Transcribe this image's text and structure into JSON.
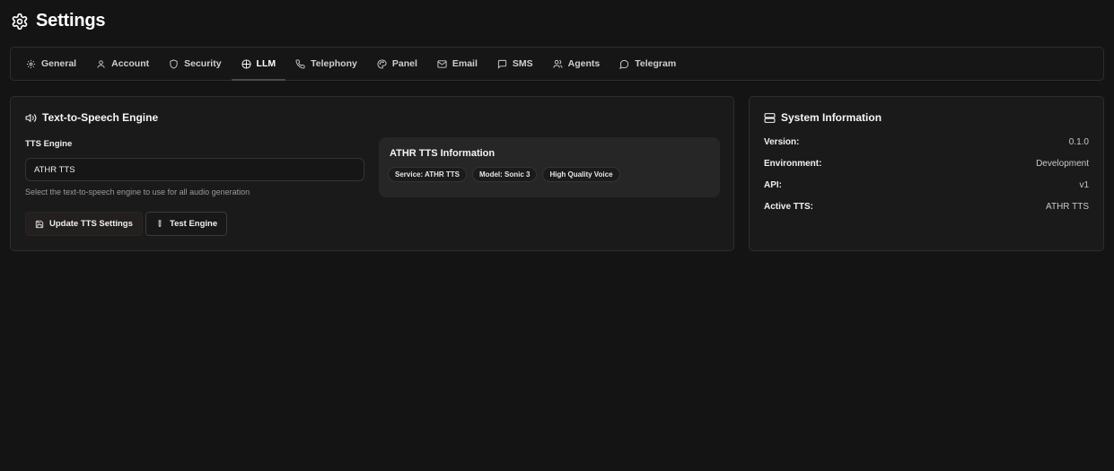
{
  "header": {
    "title": "Settings",
    "icon": "gear-icon"
  },
  "tabs": [
    {
      "label": "General",
      "icon": "gear-icon",
      "active": false
    },
    {
      "label": "Account",
      "icon": "user-icon",
      "active": false
    },
    {
      "label": "Security",
      "icon": "shield-icon",
      "active": false
    },
    {
      "label": "LLM",
      "icon": "globe-icon",
      "active": true
    },
    {
      "label": "Telephony",
      "icon": "phone-icon",
      "active": false
    },
    {
      "label": "Panel",
      "icon": "palette-icon",
      "active": false
    },
    {
      "label": "Email",
      "icon": "mail-icon",
      "active": false
    },
    {
      "label": "SMS",
      "icon": "message-icon",
      "active": false
    },
    {
      "label": "Agents",
      "icon": "users-icon",
      "active": false
    },
    {
      "label": "Telegram",
      "icon": "chat-bubble-icon",
      "active": false
    }
  ],
  "tts": {
    "title": "Text-to-Speech Engine",
    "engine_label": "TTS Engine",
    "engine_value": "ATHR TTS",
    "help": "Select the text-to-speech engine to use for all audio generation",
    "update_button": "Update TTS Settings",
    "test_button": "Test Engine",
    "info": {
      "title": "ATHR TTS Information",
      "badges": [
        "Service: ATHR TTS",
        "Model: Sonic 3",
        "High Quality Voice"
      ]
    }
  },
  "system": {
    "title": "System Information",
    "rows": [
      {
        "key": "Version:",
        "value": "0.1.0"
      },
      {
        "key": "Environment:",
        "value": "Development"
      },
      {
        "key": "API:",
        "value": "v1"
      },
      {
        "key": "Active TTS:",
        "value": "ATHR TTS"
      }
    ]
  }
}
